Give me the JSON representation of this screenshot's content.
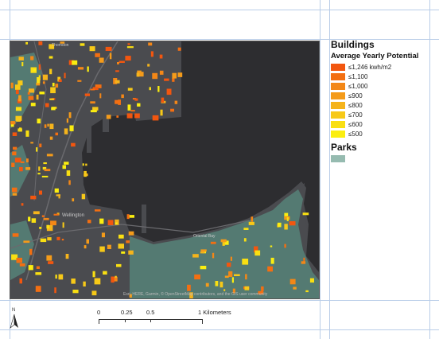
{
  "legend": {
    "buildings_heading": "Buildings",
    "subtitle": "Average Yearly Potential",
    "classes": [
      {
        "label": "≤1,246 kwh/m2",
        "color": "#f2560f"
      },
      {
        "label": "≤1,100",
        "color": "#f36f12"
      },
      {
        "label": "≤1,000",
        "color": "#f38717"
      },
      {
        "label": "≤900",
        "color": "#f49b1a"
      },
      {
        "label": "≤800",
        "color": "#f5b41c"
      },
      {
        "label": "≤700",
        "color": "#f7c918"
      },
      {
        "label": "≤600",
        "color": "#f9df12"
      },
      {
        "label": "≤500",
        "color": "#fbee10"
      }
    ],
    "parks_heading": "Parks",
    "parks_color": "#96bbb0"
  },
  "map": {
    "water_color": "#2d2d30",
    "land_color": "#4a4b4f",
    "park_color": "#547a72",
    "road_color": "#6a6a6e",
    "place_labels": [
      "Thorndon",
      "Wellington",
      "Oriental Bay"
    ],
    "attribution": "Esri, HERE, Garmin, © OpenStreetMap contributors, and the GIS user community"
  },
  "north_arrow": {
    "label": "N"
  },
  "scale_bar": {
    "ticks": [
      "0",
      "0.25",
      "0.5",
      "1 Kilometers"
    ],
    "tick_values": [
      0,
      0.25,
      0.5,
      1
    ]
  }
}
